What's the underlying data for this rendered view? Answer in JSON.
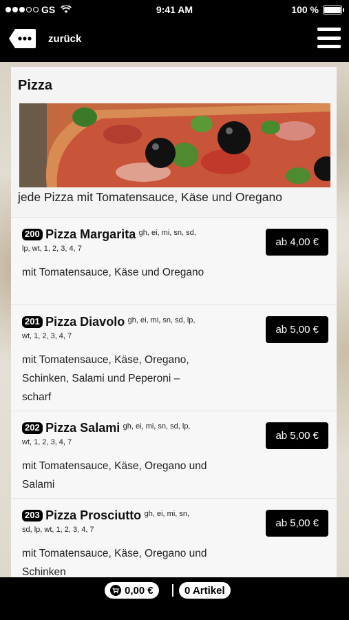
{
  "status_bar": {
    "carrier": "GS",
    "time": "9:41 AM",
    "battery": "100 %"
  },
  "nav": {
    "back_label": "zurück",
    "back_icon": "speech-bubble-dots-icon",
    "menu_icon": "hamburger-menu-icon"
  },
  "section": {
    "title": "Pizza",
    "description": "jede Pizza mit Tomatensauce, Käse und Oregano"
  },
  "items": [
    {
      "number": "200",
      "name": "Pizza Margarita",
      "allergens_1": "gh, ei, mi, sn, sd,",
      "allergens_2": "lp, wt, 1, 2, 3, 4, 7",
      "description": "mit Tomatensauce, Käse und Oregano",
      "price": "ab 4,00 €"
    },
    {
      "number": "201",
      "name": "Pizza Diavolo",
      "allergens_1": "gh, ei, mi, sn, sd, lp,",
      "allergens_2": "wt, 1, 2, 3, 4, 7",
      "description": "mit Tomatensauce, Käse, Oregano, Schinken, Salami und Peperoni – scharf",
      "price": "ab 5,00 €"
    },
    {
      "number": "202",
      "name": "Pizza Salami",
      "allergens_1": "gh, ei, mi, sn, sd, lp,",
      "allergens_2": "wt, 1, 2, 3, 4, 7",
      "description": "mit Tomatensauce, Käse, Oregano und Salami",
      "price": "ab 5,00 €"
    },
    {
      "number": "203",
      "name": "Pizza Prosciutto",
      "allergens_1": "gh, ei, mi, sn,",
      "allergens_2": "sd, lp, wt, 1, 2, 3, 4, 7",
      "description": "mit Tomatensauce, Käse, Oregano und Schinken",
      "price": "ab 5,00 €"
    }
  ],
  "bottom_bar": {
    "cart_total": "0,00 €",
    "article_count": "0 Artikel",
    "cart_icon": "shopping-cart-icon"
  }
}
